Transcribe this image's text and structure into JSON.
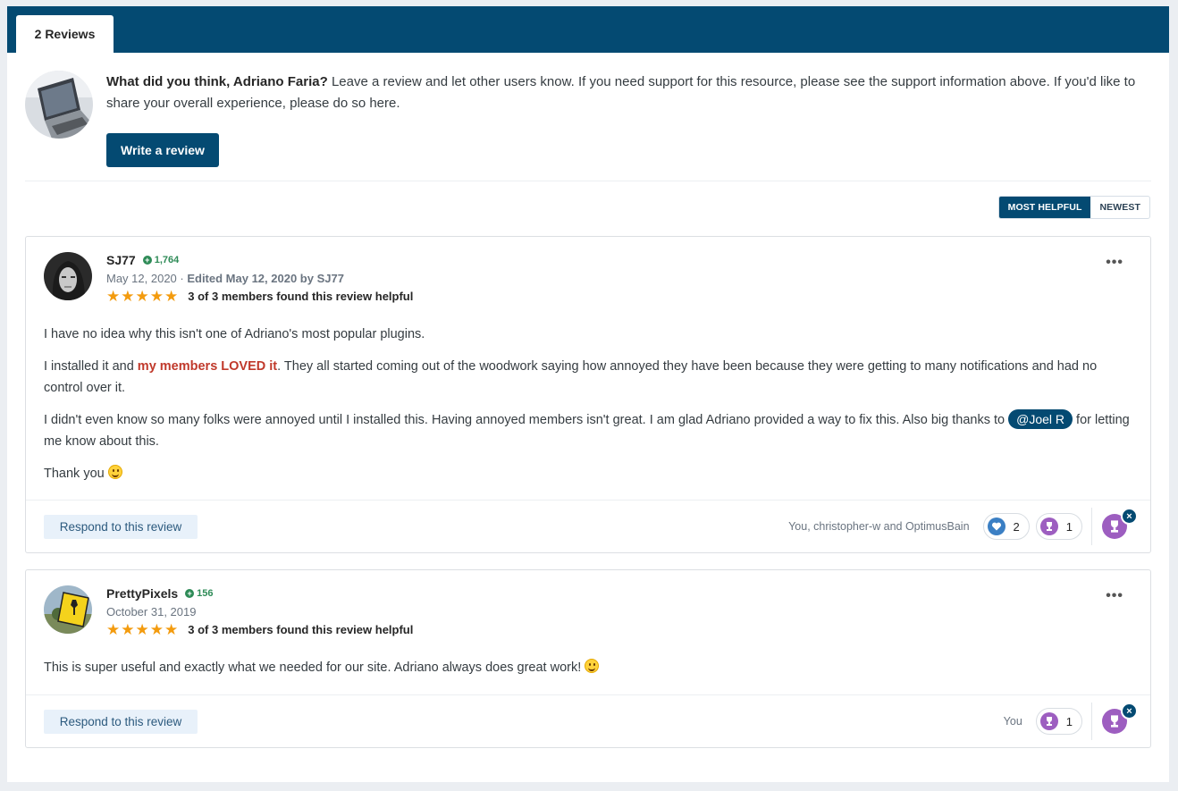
{
  "tabs": {
    "reviews_label": "2 Reviews"
  },
  "prompt": {
    "question": "What did you think, Adriano Faria?",
    "text": " Leave a review and let other users know. If you need support for this resource, please see the support information above. If you'd like to share your overall experience, please do so here.",
    "write_button": "Write a review"
  },
  "sort": {
    "most_helpful": "MOST HELPFUL",
    "newest": "NEWEST"
  },
  "reviews": [
    {
      "author": "SJ77",
      "reputation": "1,764",
      "date": "May 12, 2020 · ",
      "edited": "Edited May 12, 2020 by SJ77",
      "rating": 5,
      "helpful": "3 of 3 members found this review helpful",
      "p1": "I have no idea why this isn't one of Adriano's most popular plugins.",
      "p2_a": "I installed it and ",
      "p2_hl": "my members LOVED it",
      "p2_b": ". They all started coming out of the woodwork saying how annoyed they have been because they were getting to many notifications and had no control over it.",
      "p3_a": "I didn't even know so many folks were annoyed until I installed this.  Having annoyed members isn't great. I am glad Adriano provided a way to fix this.  Also big thanks to ",
      "p3_mention": "@Joel R",
      "p3_b": " for letting me know about this.",
      "p4": "Thank you ",
      "respond": "Respond to this review",
      "reacted_by": "You, christopher-w and OptimusBain",
      "like_count": "2",
      "trophy_count": "1",
      "remove_reaction": "×"
    },
    {
      "author": "PrettyPixels",
      "reputation": "156",
      "date": "October 31, 2019",
      "rating": 5,
      "helpful": "3 of 3 members found this review helpful",
      "p1": "This is super useful and exactly what we needed for our site. Adriano always does great work! ",
      "respond": "Respond to this review",
      "reacted_by": "You",
      "trophy_count": "1",
      "remove_reaction": "×"
    }
  ],
  "colors": {
    "brand": "#044a72",
    "rep": "#2e8b57",
    "star": "#f39b0e",
    "highlight": "#c0392b",
    "trophy": "#9d5ec0",
    "like": "#3b7fc4"
  }
}
